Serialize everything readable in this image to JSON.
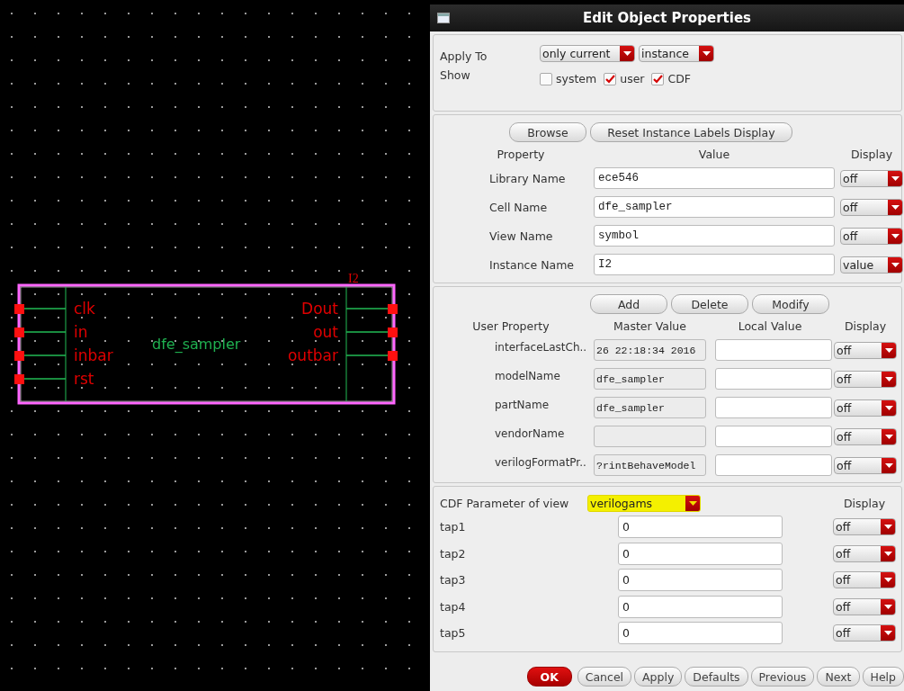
{
  "schematic": {
    "instance_label": "I2",
    "cell_label": "dfe_sampler",
    "left_pins": [
      "clk",
      "in",
      "inbar",
      "rst"
    ],
    "right_pins": [
      "Dout",
      "out",
      "outbar"
    ]
  },
  "dialog": {
    "title": "Edit Object Properties",
    "apply_to": {
      "label": "Apply To",
      "scope": "only current",
      "target": "instance"
    },
    "show": {
      "label": "Show",
      "options": [
        {
          "label": "system",
          "checked": false
        },
        {
          "label": "user",
          "checked": true
        },
        {
          "label": "CDF",
          "checked": true
        }
      ]
    },
    "instance_section": {
      "buttons": [
        "Browse",
        "Reset Instance Labels Display"
      ],
      "columns": [
        "Property",
        "Value",
        "Display"
      ],
      "rows": [
        {
          "property": "Library Name",
          "value": "ece546",
          "display": "off"
        },
        {
          "property": "Cell Name",
          "value": "dfe_sampler",
          "display": "off"
        },
        {
          "property": "View Name",
          "value": "symbol",
          "display": "off"
        },
        {
          "property": "Instance Name",
          "value": "I2",
          "display": "value"
        }
      ]
    },
    "user_section": {
      "buttons": [
        "Add",
        "Delete",
        "Modify"
      ],
      "columns": [
        "User Property",
        "Master Value",
        "Local Value",
        "Display"
      ],
      "rows": [
        {
          "property": "interfaceLastCh..",
          "master": "26 22:18:34 2016",
          "display": "off"
        },
        {
          "property": "modelName",
          "master": "dfe_sampler",
          "display": "off"
        },
        {
          "property": "partName",
          "master": "dfe_sampler",
          "display": "off"
        },
        {
          "property": "vendorName",
          "display": "off"
        },
        {
          "property": "verilogFormatPr..",
          "master": "?rintBehaveModel",
          "display": "off"
        }
      ]
    },
    "cdf_section": {
      "label": "CDF Parameter of view",
      "view": "verilogams",
      "highlighted": true,
      "display_header": "Display",
      "rows": [
        {
          "name": "tap1",
          "value": "0",
          "display": "off"
        },
        {
          "name": "tap2",
          "value": "0",
          "display": "off"
        },
        {
          "name": "tap3",
          "value": "0",
          "display": "off"
        },
        {
          "name": "tap4",
          "value": "0",
          "display": "off"
        },
        {
          "name": "tap5",
          "value": "0",
          "display": "off"
        }
      ]
    },
    "buttons": [
      {
        "label": "OK",
        "default": true
      },
      {
        "label": "Cancel",
        "default": false
      },
      {
        "label": "Apply",
        "default": false
      },
      {
        "label": "Defaults",
        "default": false
      },
      {
        "label": "Previous",
        "default": false
      },
      {
        "label": "Next",
        "default": false
      },
      {
        "label": "Help",
        "default": false
      }
    ]
  }
}
